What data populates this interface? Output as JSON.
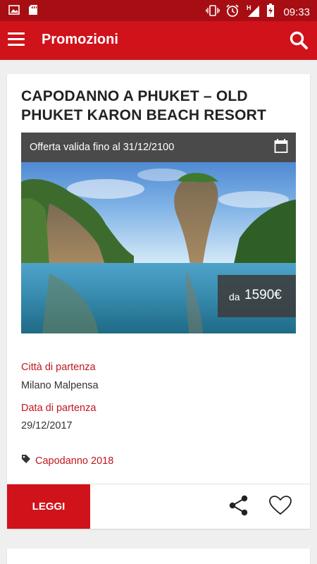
{
  "status_bar": {
    "time": "09:33",
    "icons": [
      "image-icon",
      "sd-card-icon",
      "vibrate-icon",
      "alarm-icon",
      "signal-icon",
      "battery-charging-icon"
    ]
  },
  "appbar": {
    "title": "Promozioni",
    "menu_icon": "menu-icon",
    "search_icon": "search-icon"
  },
  "promo": {
    "title": "CAPODANNO A PHUKET – OLD PHUKET KARON BEACH RESORT",
    "offer_text": "Offerta valida fino al 31/12/2100",
    "price_prefix": "da",
    "price": "1590€",
    "departure_city_label": "Città di partenza",
    "departure_city": "Milano Malpensa",
    "departure_date_label": "Data di partenza",
    "departure_date": "29/12/2017",
    "tag": "Capodanno 2018",
    "read_button": "LEGGI"
  },
  "colors": {
    "accent": "#d0121a",
    "status_bar": "#a70e13",
    "label_red": "#c0171d"
  }
}
